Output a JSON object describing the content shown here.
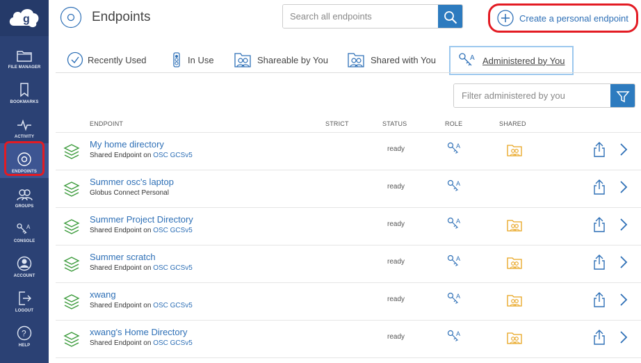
{
  "sidebar": {
    "items": [
      {
        "label": "FILE MANAGER",
        "icon": "folder-icon"
      },
      {
        "label": "BOOKMARKS",
        "icon": "bookmark-icon"
      },
      {
        "label": "ACTIVITY",
        "icon": "activity-icon"
      },
      {
        "label": "ENDPOINTS",
        "icon": "endpoints-icon"
      },
      {
        "label": "GROUPS",
        "icon": "groups-icon"
      },
      {
        "label": "CONSOLE",
        "icon": "console-icon"
      },
      {
        "label": "ACCOUNT",
        "icon": "account-icon"
      },
      {
        "label": "LOGOUT",
        "icon": "logout-icon"
      },
      {
        "label": "HELP",
        "icon": "help-icon"
      }
    ]
  },
  "header": {
    "title": "Endpoints",
    "search_placeholder": "Search all endpoints",
    "create_label": "Create a personal endpoint"
  },
  "tabs": [
    {
      "label": "Recently Used",
      "icon": "clock-check-icon"
    },
    {
      "label": "In Use",
      "icon": "traffic-light-icon"
    },
    {
      "label": "Shareable by You",
      "icon": "shareable-icon"
    },
    {
      "label": "Shared with You",
      "icon": "shared-with-icon"
    },
    {
      "label": "Administered by You",
      "icon": "admin-keys-icon",
      "active": true
    }
  ],
  "filter": {
    "placeholder": "Filter administered by you"
  },
  "table": {
    "columns": {
      "endpoint": "ENDPOINT",
      "strict": "STRICT",
      "status": "STATUS",
      "role": "ROLE",
      "shared": "SHARED"
    },
    "rows": [
      {
        "name": "My home directory",
        "type": "Shared Endpoint on ",
        "host": "OSC GCSv5",
        "status": "ready",
        "shared": true
      },
      {
        "name": "Summer osc's laptop",
        "type": "Globus Connect Personal",
        "host": "",
        "status": "ready",
        "shared": false
      },
      {
        "name": "Summer Project Directory",
        "type": "Shared Endpoint on ",
        "host": "OSC GCSv5",
        "status": "ready",
        "shared": true
      },
      {
        "name": "Summer scratch",
        "type": "Shared Endpoint on ",
        "host": "OSC GCSv5",
        "status": "ready",
        "shared": true
      },
      {
        "name": "xwang",
        "type": "Shared Endpoint on ",
        "host": "OSC GCSv5",
        "status": "ready",
        "shared": true
      },
      {
        "name": "xwang's Home Directory",
        "type": "Shared Endpoint on ",
        "host": "OSC GCSv5",
        "status": "ready",
        "shared": true
      }
    ]
  },
  "colors": {
    "sidebar": "#2b4174",
    "accent": "#2d7bbf",
    "link": "#2d6fb6",
    "highlight": "#e31b23",
    "layers_green": "#3a9a3a",
    "shared_orange": "#e8a31c"
  }
}
